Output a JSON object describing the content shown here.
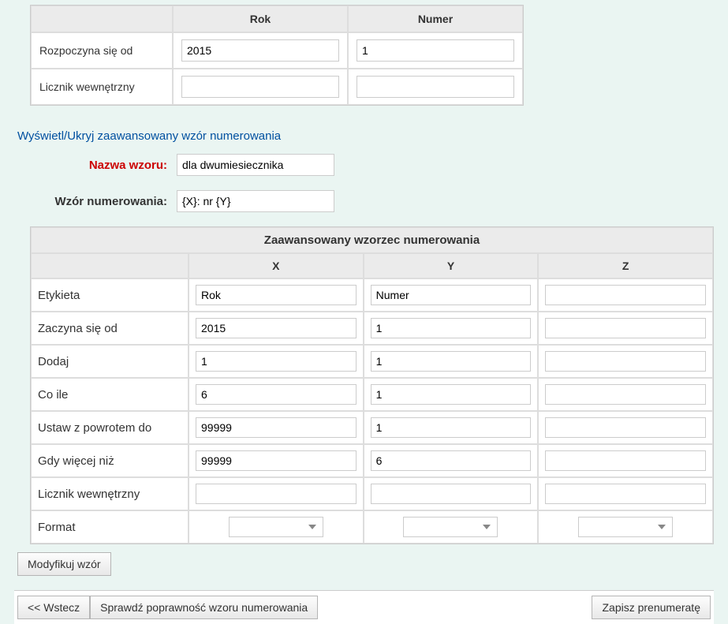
{
  "top_table": {
    "col1_header": "Rok",
    "col2_header": "Numer",
    "row1_label": "Rozpoczyna się od",
    "row1_col1": "2015",
    "row1_col2": "1",
    "row2_label": "Licznik wewnętrzny",
    "row2_col1": "",
    "row2_col2": ""
  },
  "adv_toggle": "Wyświetl/Ukryj zaawansowany wzór numerowania",
  "pattern_name_label": "Nazwa wzoru:",
  "pattern_name_value": "dla dwumiesiecznika",
  "numbering_label": "Wzór numerowania:",
  "numbering_value": "{X}: nr {Y}",
  "adv": {
    "title": "Zaawansowany wzorzec numerowania",
    "col_x": "X",
    "col_y": "Y",
    "col_z": "Z",
    "rows": {
      "etykieta": {
        "label": "Etykieta",
        "x": "Rok",
        "y": "Numer",
        "z": ""
      },
      "zaczyna": {
        "label": "Zaczyna się od",
        "x": "2015",
        "y": "1",
        "z": ""
      },
      "dodaj": {
        "label": "Dodaj",
        "x": "1",
        "y": "1",
        "z": ""
      },
      "coile": {
        "label": "Co ile",
        "x": "6",
        "y": "1",
        "z": ""
      },
      "ustaw": {
        "label": "Ustaw z powrotem do",
        "x": "99999",
        "y": "1",
        "z": ""
      },
      "gdy": {
        "label": "Gdy więcej niż",
        "x": "99999",
        "y": "6",
        "z": ""
      },
      "licznik": {
        "label": "Licznik wewnętrzny",
        "x": "",
        "y": "",
        "z": ""
      },
      "format": {
        "label": "Format",
        "x": "",
        "y": "",
        "z": ""
      }
    }
  },
  "buttons": {
    "modify": "Modyfikuj wzór",
    "back": "<< Wstecz",
    "validate": "Sprawdź poprawność wzoru numerowania",
    "save": "Zapisz prenumeratę"
  }
}
